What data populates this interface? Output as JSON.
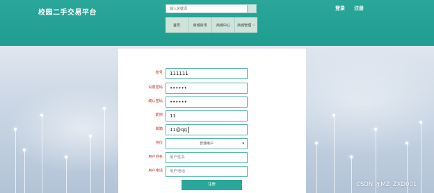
{
  "header": {
    "site_title": "校园二手交易平台",
    "search_placeholder": "输入关键词",
    "login": "登录",
    "register": "注册",
    "nav": [
      {
        "label": "首页"
      },
      {
        "label": "商城资讯"
      },
      {
        "label": "商城中心"
      },
      {
        "label": "商城管理"
      }
    ]
  },
  "form": {
    "fields": [
      {
        "label": "账号",
        "value": "111111"
      },
      {
        "label": "设置密码",
        "value": "••••••"
      },
      {
        "label": "确认密码",
        "value": "••••••"
      },
      {
        "label": "昵称",
        "value": "11"
      },
      {
        "label": "邮箱",
        "value": "11@qq"
      },
      {
        "label": "身份",
        "value": "普通用户"
      },
      {
        "label": "用户姓名",
        "placeholder": "用户姓名"
      },
      {
        "label": "用户电话",
        "placeholder": "用户电话"
      }
    ],
    "submit_label": "注册"
  },
  "watermark": "CSDN @MZ_ZXD001"
}
